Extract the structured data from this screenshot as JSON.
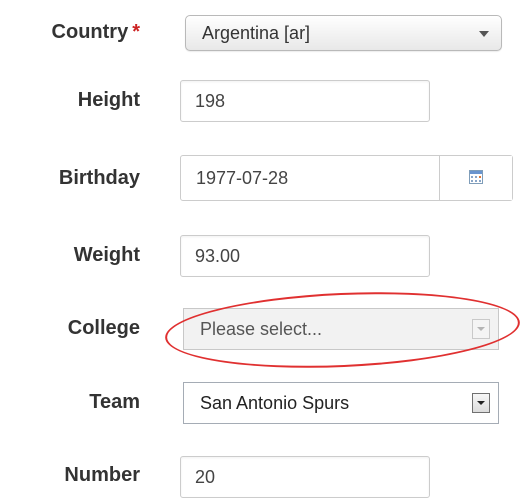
{
  "form": {
    "country": {
      "label": "Country",
      "required_mark": "*",
      "value": "Argentina [ar]"
    },
    "height": {
      "label": "Height",
      "value": "198"
    },
    "birthday": {
      "label": "Birthday",
      "value": "1977-07-28",
      "icon": "calendar-icon"
    },
    "weight": {
      "label": "Weight",
      "value": "93.00"
    },
    "college": {
      "label": "College",
      "value": "Please select...",
      "disabled": true
    },
    "team": {
      "label": "Team",
      "value": "San Antonio Spurs"
    },
    "number": {
      "label": "Number",
      "value": "20"
    }
  },
  "colors": {
    "label_text": "#333333",
    "required_mark": "#cc2222",
    "highlight_annotation": "#e03030"
  }
}
